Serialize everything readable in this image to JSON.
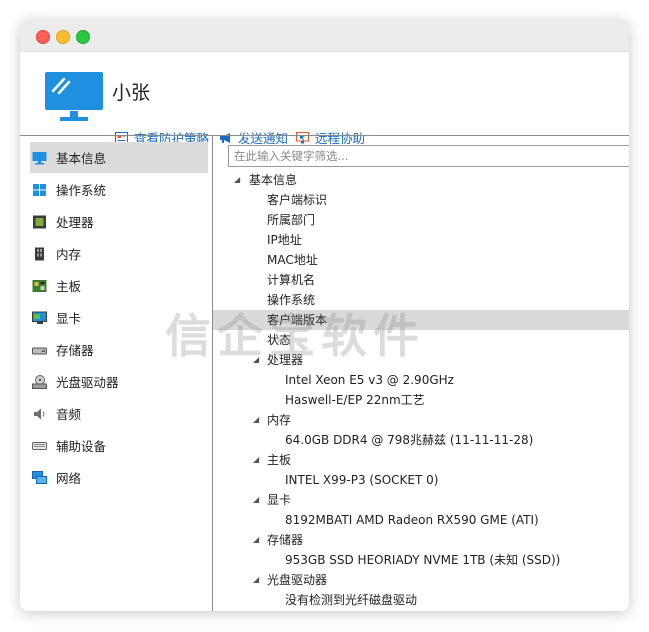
{
  "header": {
    "user_name": "小张",
    "actions": [
      {
        "label": "查看防护策略",
        "icon": "shield-policy-icon"
      },
      {
        "label": "发送通知",
        "icon": "megaphone-icon"
      },
      {
        "label": "远程协助",
        "icon": "remote-screen-icon"
      }
    ]
  },
  "sidebar": {
    "items": [
      {
        "label": "基本信息",
        "icon": "monitor-icon",
        "selected": true
      },
      {
        "label": "操作系统",
        "icon": "windows-icon"
      },
      {
        "label": "处理器",
        "icon": "cpu-icon"
      },
      {
        "label": "内存",
        "icon": "memory-icon"
      },
      {
        "label": "主板",
        "icon": "motherboard-icon"
      },
      {
        "label": "显卡",
        "icon": "graphics-card-icon"
      },
      {
        "label": "存储器",
        "icon": "storage-icon"
      },
      {
        "label": "光盘驱动器",
        "icon": "optical-drive-icon"
      },
      {
        "label": "音频",
        "icon": "speaker-icon"
      },
      {
        "label": "辅助设备",
        "icon": "keyboard-icon"
      },
      {
        "label": "网络",
        "icon": "network-icon"
      }
    ]
  },
  "search": {
    "placeholder": "在此输入关键字筛选..."
  },
  "tree": {
    "root": "基本信息",
    "basic_fields": [
      "客户端标识",
      "所属部门",
      "IP地址",
      "MAC地址",
      "计算机名",
      "操作系统",
      "客户端版本",
      "状态"
    ],
    "highlighted_field": "客户端版本",
    "groups": [
      {
        "label": "处理器",
        "children": [
          "Intel Xeon E5 v3 @ 2.90GHz",
          "Haswell-E/EP 22nm工艺"
        ]
      },
      {
        "label": "内存",
        "children": [
          "64.0GB DDR4 @ 798兆赫兹 (11-11-11-28)"
        ]
      },
      {
        "label": "主板",
        "children": [
          "INTEL X99-P3 (SOCKET 0)"
        ]
      },
      {
        "label": "显卡",
        "children": [
          "8192MBATI AMD Radeon RX590 GME (ATI)"
        ]
      },
      {
        "label": "存储器",
        "children": [
          "953GB SSD HEORIADY NVME 1TB (未知 (SSD))"
        ]
      },
      {
        "label": "光盘驱动器",
        "children": [
          "没有检测到光纤磁盘驱动"
        ]
      }
    ]
  },
  "watermark": "信企宝软件",
  "colors": {
    "accent": "#1a6cc4",
    "monitor_blue": "#1f8fe0",
    "selection": "#dcdcdc"
  }
}
